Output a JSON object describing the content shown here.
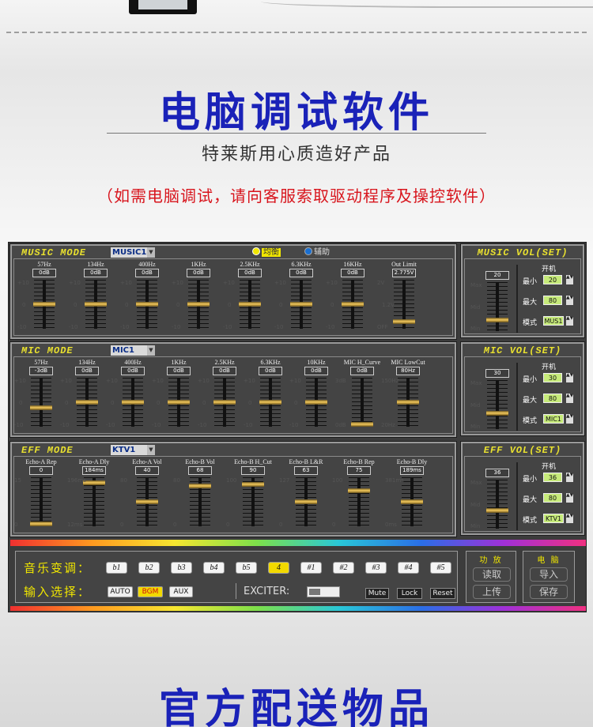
{
  "header": {
    "title": "电脑调试软件",
    "subtitle": "特莱斯用心质造好产品",
    "note": "（如需电脑调试，请向客服索取驱动程序及操控软件）"
  },
  "footer": {
    "title": "官方配送物品"
  },
  "music_panel": {
    "title": "MUSIC MODE",
    "mode_value": "MUSIC1",
    "radio_eq": "均衡",
    "radio_aux": "辅助",
    "faders": [
      {
        "label": "57Hz",
        "value": "0dB",
        "level": 0.5
      },
      {
        "label": "134Hz",
        "value": "0dB",
        "level": 0.5
      },
      {
        "label": "400Hz",
        "value": "0dB",
        "level": 0.5
      },
      {
        "label": "1KHz",
        "value": "0dB",
        "level": 0.5
      },
      {
        "label": "2.5KHz",
        "value": "0dB",
        "level": 0.5
      },
      {
        "label": "6.3KHz",
        "value": "0dB",
        "level": 0.5
      },
      {
        "label": "16KHz",
        "value": "0dB",
        "level": 0.5
      },
      {
        "label": "Out Limit",
        "value": "2.775V",
        "level": 0.1
      }
    ],
    "scale_gain": {
      "top": "+10",
      "mid": "0",
      "bot": "-10"
    },
    "scale_limit": {
      "top": "2V",
      "mid": "1.2V",
      "bot": "OFF"
    }
  },
  "mic_panel": {
    "title": "MIC MODE",
    "mode_value": "MIC1",
    "faders": [
      {
        "label": "57Hz",
        "value": "-3dB",
        "level": 0.38
      },
      {
        "label": "134Hz",
        "value": "0dB",
        "level": 0.5
      },
      {
        "label": "400Hz",
        "value": "0dB",
        "level": 0.5
      },
      {
        "label": "1KHz",
        "value": "0dB",
        "level": 0.5
      },
      {
        "label": "2.5KHz",
        "value": "0dB",
        "level": 0.5
      },
      {
        "label": "6.3KHz",
        "value": "0dB",
        "level": 0.5
      },
      {
        "label": "10KHz",
        "value": "0dB",
        "level": 0.5
      },
      {
        "label": "MIC H_Curve",
        "value": "0dB",
        "level": 0.0
      },
      {
        "label": "MIC LowCut",
        "value": "80Hz",
        "level": 0.5
      }
    ],
    "scale_gain": {
      "top": "+10",
      "mid": "0",
      "bot": "-10"
    },
    "scale_curve": {
      "top": "3dB",
      "bot": "0dB"
    },
    "scale_lowcut": {
      "top": "150Hz",
      "bot": "20Hz"
    }
  },
  "eff_panel": {
    "title": "EFF MODE",
    "mode_value": "KTV1",
    "faders": [
      {
        "label": "Echo-A Rep",
        "value": "0",
        "level": 0.0,
        "top": "15",
        "bot": "0"
      },
      {
        "label": "Echo-A Dly",
        "value": "184ms",
        "level": 0.92,
        "top": "196ms",
        "bot": "12ms"
      },
      {
        "label": "Echo-A Vol",
        "value": "40",
        "level": 0.5,
        "top": "80",
        "bot": "0"
      },
      {
        "label": "Echo-B Vol",
        "value": "68",
        "level": 0.85,
        "top": "80",
        "bot": "0"
      },
      {
        "label": "Echo-B H_Cut",
        "value": "90",
        "level": 0.9,
        "top": "100",
        "bot": "0"
      },
      {
        "label": "Echo-B L&R",
        "value": "63",
        "level": 0.5,
        "top": "127",
        "bot": "0"
      },
      {
        "label": "Echo-B Rep",
        "value": "75",
        "level": 0.75,
        "top": "100",
        "bot": "0"
      },
      {
        "label": "Echo-B Dly",
        "value": "189ms",
        "level": 0.5,
        "top": "381ms",
        "bot": "0ms"
      }
    ]
  },
  "music_vol": {
    "title": "MUSIC VOL(SET)",
    "value": "20",
    "level": 0.2,
    "on": "开机",
    "min_label": "最小",
    "min": "20",
    "max_label": "最大",
    "max": "80",
    "mode_label": "模式",
    "mode": "MUS1",
    "scale": {
      "max": "Max",
      "mid": "Mid",
      "min": "Min"
    }
  },
  "mic_vol": {
    "title": "MIC VOL(SET)",
    "value": "30",
    "level": 0.3,
    "on": "开机",
    "min_label": "最小",
    "min": "30",
    "max_label": "最大",
    "max": "80",
    "mode_label": "模式",
    "mode": "MIC1",
    "scale": {
      "max": "Max",
      "mid": "Mid",
      "min": "Min"
    }
  },
  "eff_vol": {
    "title": "EFF VOL(SET)",
    "value": "36",
    "level": 0.36,
    "on": "开机",
    "min_label": "最小",
    "min": "36",
    "max_label": "最大",
    "max": "80",
    "mode_label": "模式",
    "mode": "KTV1",
    "scale": {
      "max": "Max",
      "mid": "Mid",
      "min": "Min"
    }
  },
  "bottom": {
    "key_label": "音乐变调：",
    "keys": [
      "b1",
      "b2",
      "b3",
      "b4",
      "b5",
      "4",
      "#1",
      "#2",
      "#3",
      "#4",
      "#5"
    ],
    "key_selected": "4",
    "input_label": "输入选择：",
    "inputs": [
      "AUTO",
      "BGM",
      "AUX"
    ],
    "input_selected": "BGM",
    "exciter_label": "EXCITER:",
    "buttons": [
      "Mute",
      "Lock",
      "Reset"
    ],
    "amp": {
      "title": "功 放",
      "read": "读取",
      "upload": "上传"
    },
    "pc": {
      "title": "电 脑",
      "import": "导入",
      "save": "保存"
    }
  }
}
